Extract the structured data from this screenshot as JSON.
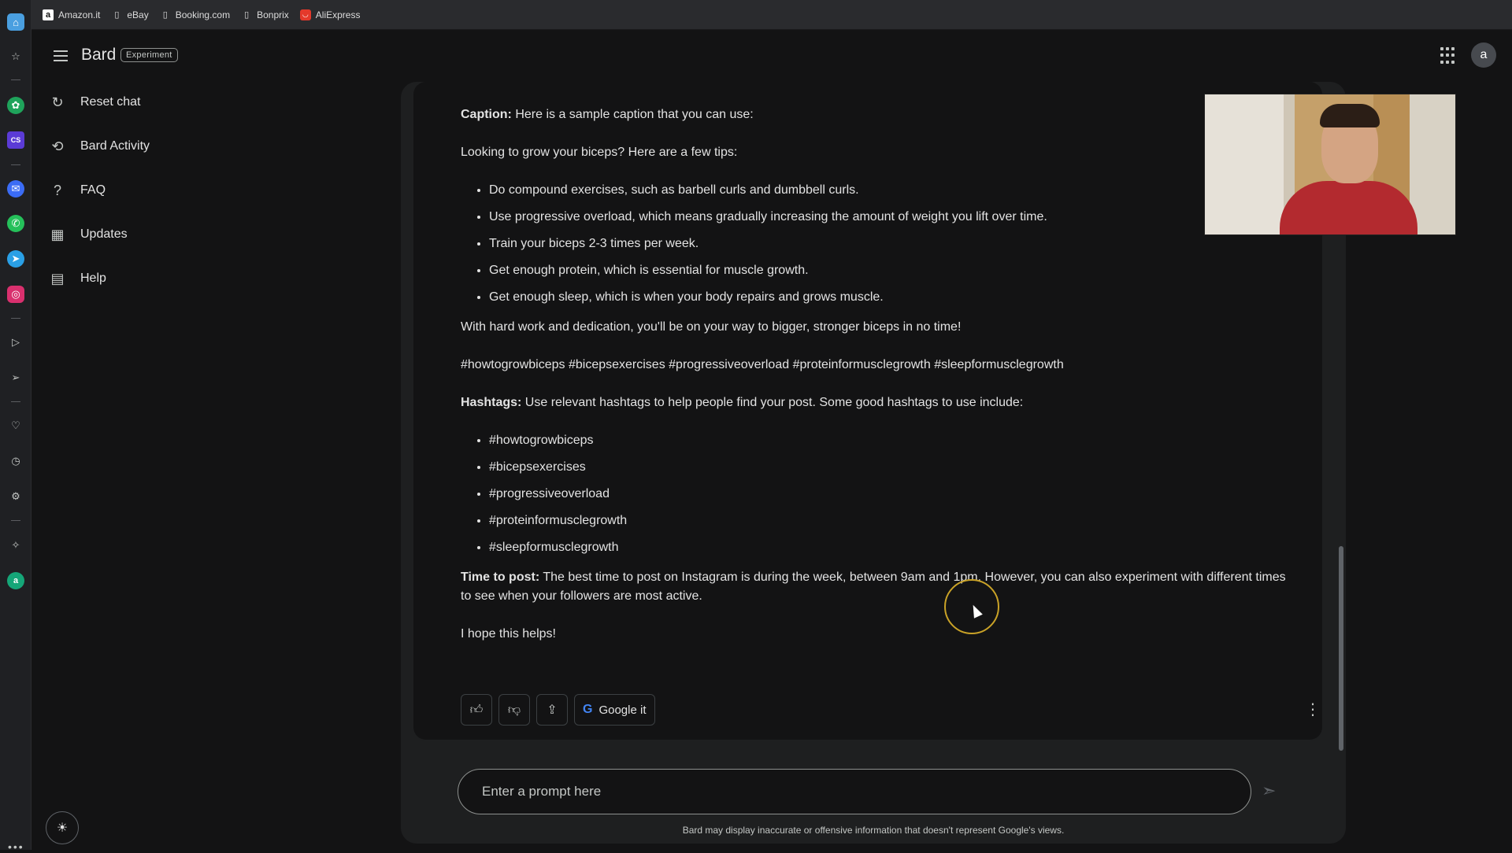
{
  "bookmarks": [
    {
      "label": "Amazon.it",
      "icon": "amazon-icon"
    },
    {
      "label": "eBay",
      "icon": "page-icon"
    },
    {
      "label": "Booking.com",
      "icon": "page-icon"
    },
    {
      "label": "Bonprix",
      "icon": "page-icon"
    },
    {
      "label": "AliExpress",
      "icon": "aliexpress-icon"
    }
  ],
  "app": {
    "brand": "Bard",
    "badge": "Experiment",
    "avatar_letter": "a"
  },
  "sidebar": {
    "items": [
      {
        "label": "Reset chat",
        "icon": "reset-icon"
      },
      {
        "label": "Bard Activity",
        "icon": "history-icon"
      },
      {
        "label": "FAQ",
        "icon": "help-circle-icon"
      },
      {
        "label": "Updates",
        "icon": "calendar-icon"
      },
      {
        "label": "Help",
        "icon": "feedback-icon"
      }
    ]
  },
  "response": {
    "caption_label": "Caption:",
    "caption_text": " Here is a sample caption that you can use:",
    "intro": "Looking to grow your biceps? Here are a few tips:",
    "tips": [
      "Do compound exercises, such as barbell curls and dumbbell curls.",
      "Use progressive overload, which means gradually increasing the amount of weight you lift over time.",
      "Train your biceps 2-3 times per week.",
      "Get enough protein, which is essential for muscle growth.",
      "Get enough sleep, which is when your body repairs and grows muscle."
    ],
    "closing": "With hard work and dedication, you'll be on your way to bigger, stronger biceps in no time!",
    "hashtag_line": "#howtogrowbiceps #bicepsexercises #progressiveoverload #proteinformusclegrowth #sleepformusclegrowth",
    "hashtags_label": "Hashtags:",
    "hashtags_text": " Use relevant hashtags to help people find your post. Some good hashtags to use include:",
    "hashtags": [
      "#howtogrowbiceps",
      "#bicepsexercises",
      "#progressiveoverload",
      "#proteinformusclegrowth",
      "#sleepformusclegrowth"
    ],
    "time_label": "Time to post:",
    "time_text": " The best time to post on Instagram is during the week, between 9am and 1pm. However, you can also experiment with different times to see when your followers are most active.",
    "sign_off": "I hope this helps!"
  },
  "actions": {
    "google_label": "Google it"
  },
  "prompt": {
    "placeholder": "Enter a prompt here"
  },
  "disclaimer": "Bard may display inaccurate or offensive information that doesn't represent Google's views.",
  "colors": {
    "background": "#131314",
    "panel": "#1e1f20",
    "text": "#e3e3e3",
    "muted": "#c4c7c5"
  }
}
